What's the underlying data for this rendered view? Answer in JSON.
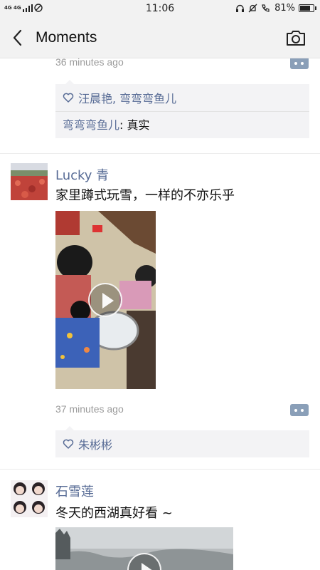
{
  "status_bar": {
    "network": "4G 4G",
    "time": "11:06",
    "battery": "81%",
    "battery_level": 0.81
  },
  "nav": {
    "title": "Moments",
    "back_icon": "chevron-left-icon",
    "camera_icon": "camera-icon"
  },
  "posts": [
    {
      "time": "36 minutes ago",
      "likes": "汪晨艳, 弯弯弯鱼儿",
      "comment_author": "弯弯弯鱼儿",
      "comment_text": ": 真实"
    },
    {
      "user": "Lucky 青",
      "text": "家里蹲式玩雪，一样的不亦乐乎",
      "time": "37 minutes ago",
      "likes": "朱彬彬"
    },
    {
      "user": "石雪莲",
      "text": "冬天的西湖真好看 ~"
    }
  ],
  "colors": {
    "link": "#576b95",
    "bar": "#f2f2f2",
    "more_button": "#8a9fb8"
  }
}
